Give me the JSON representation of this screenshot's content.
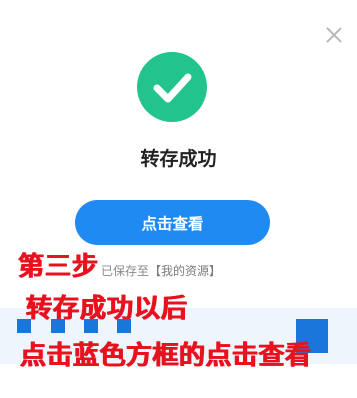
{
  "dialog": {
    "title": "转存成功",
    "view_button_label": "点击查看",
    "saved_prefix": "已保存至",
    "saved_location": "【我的资源】"
  },
  "annotation": {
    "line1": "第三步",
    "line2": "转存成功以后",
    "line3": "点击蓝色方框的点击查看"
  },
  "icons": {
    "close": "close-icon",
    "success": "checkmark-icon"
  },
  "colors": {
    "success_green": "#22c38d",
    "button_blue": "#1f8af1",
    "annotation_red": "#e8121f"
  }
}
